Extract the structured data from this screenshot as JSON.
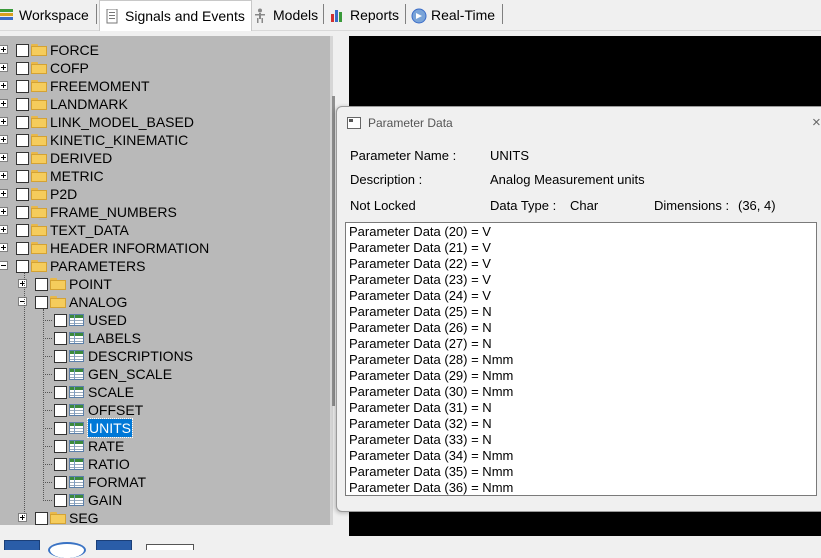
{
  "tabs": [
    {
      "label": "Workspace",
      "icon": "workspace-icon",
      "active": false
    },
    {
      "label": "Signals and Events",
      "icon": "signals-icon",
      "active": true
    },
    {
      "label": "Models",
      "icon": "models-icon",
      "active": false
    },
    {
      "label": "Reports",
      "icon": "reports-icon",
      "active": false
    },
    {
      "label": "Real-Time",
      "icon": "realtime-icon",
      "active": false
    }
  ],
  "tree": {
    "items": [
      {
        "label": "FORCE",
        "level": 0,
        "expander": "plus",
        "icon": "folder"
      },
      {
        "label": "COFP",
        "level": 0,
        "expander": "plus",
        "icon": "folder"
      },
      {
        "label": "FREEMOMENT",
        "level": 0,
        "expander": "plus",
        "icon": "folder"
      },
      {
        "label": "LANDMARK",
        "level": 0,
        "expander": "plus",
        "icon": "folder"
      },
      {
        "label": "LINK_MODEL_BASED",
        "level": 0,
        "expander": "plus",
        "icon": "folder"
      },
      {
        "label": "KINETIC_KINEMATIC",
        "level": 0,
        "expander": "plus",
        "icon": "folder"
      },
      {
        "label": "DERIVED",
        "level": 0,
        "expander": "plus",
        "icon": "folder"
      },
      {
        "label": "METRIC",
        "level": 0,
        "expander": "plus",
        "icon": "folder"
      },
      {
        "label": "P2D",
        "level": 0,
        "expander": "plus",
        "icon": "folder"
      },
      {
        "label": "FRAME_NUMBERS",
        "level": 0,
        "expander": "plus",
        "icon": "folder"
      },
      {
        "label": "TEXT_DATA",
        "level": 0,
        "expander": "plus",
        "icon": "folder"
      },
      {
        "label": "HEADER INFORMATION",
        "level": 0,
        "expander": "plus",
        "icon": "folder"
      },
      {
        "label": "PARAMETERS",
        "level": 0,
        "expander": "minus",
        "icon": "folder"
      },
      {
        "label": "POINT",
        "level": 1,
        "expander": "plus",
        "icon": "folder"
      },
      {
        "label": "ANALOG",
        "level": 1,
        "expander": "minus",
        "icon": "folder"
      },
      {
        "label": "USED",
        "level": 2,
        "expander": "none",
        "icon": "grid"
      },
      {
        "label": "LABELS",
        "level": 2,
        "expander": "none",
        "icon": "grid"
      },
      {
        "label": "DESCRIPTIONS",
        "level": 2,
        "expander": "none",
        "icon": "grid"
      },
      {
        "label": "GEN_SCALE",
        "level": 2,
        "expander": "none",
        "icon": "grid"
      },
      {
        "label": "SCALE",
        "level": 2,
        "expander": "none",
        "icon": "grid"
      },
      {
        "label": "OFFSET",
        "level": 2,
        "expander": "none",
        "icon": "grid"
      },
      {
        "label": "UNITS",
        "level": 2,
        "expander": "none",
        "icon": "grid",
        "selected": true
      },
      {
        "label": "RATE",
        "level": 2,
        "expander": "none",
        "icon": "grid"
      },
      {
        "label": "RATIO",
        "level": 2,
        "expander": "none",
        "icon": "grid"
      },
      {
        "label": "FORMAT",
        "level": 2,
        "expander": "none",
        "icon": "grid"
      },
      {
        "label": "GAIN",
        "level": 2,
        "expander": "none",
        "icon": "grid"
      },
      {
        "label": "SEG",
        "level": 1,
        "expander": "plus",
        "icon": "folder"
      }
    ]
  },
  "dialog": {
    "title": "Parameter Data",
    "close_glyph": "×",
    "param_name_label": "Parameter Name :",
    "param_name_value": "UNITS",
    "description_label": "Description :",
    "description_value": "Analog Measurement units",
    "lock_status": "Not Locked",
    "data_type_label": "Data Type :",
    "data_type_value": "Char",
    "dimensions_label": "Dimensions :",
    "dimensions_value": "(36, 4)",
    "values": [
      "Parameter Data (20) = V",
      "Parameter Data (21) = V",
      "Parameter Data (22) = V",
      "Parameter Data (23) = V",
      "Parameter Data (24) = V",
      "Parameter Data (25) = N",
      "Parameter Data (26) = N",
      "Parameter Data (27) = N",
      "Parameter Data (28) = Nmm",
      "Parameter Data (29) = Nmm",
      "Parameter Data (30) = Nmm",
      "Parameter Data (31) = N",
      "Parameter Data (32) = N",
      "Parameter Data (33) = N",
      "Parameter Data (34) = Nmm",
      "Parameter Data (35) = Nmm",
      "Parameter Data (36) = Nmm"
    ]
  },
  "colors": {
    "tree_background": "#b9b9b9",
    "viewport_background": "#000000",
    "selection": "#0078d7"
  }
}
